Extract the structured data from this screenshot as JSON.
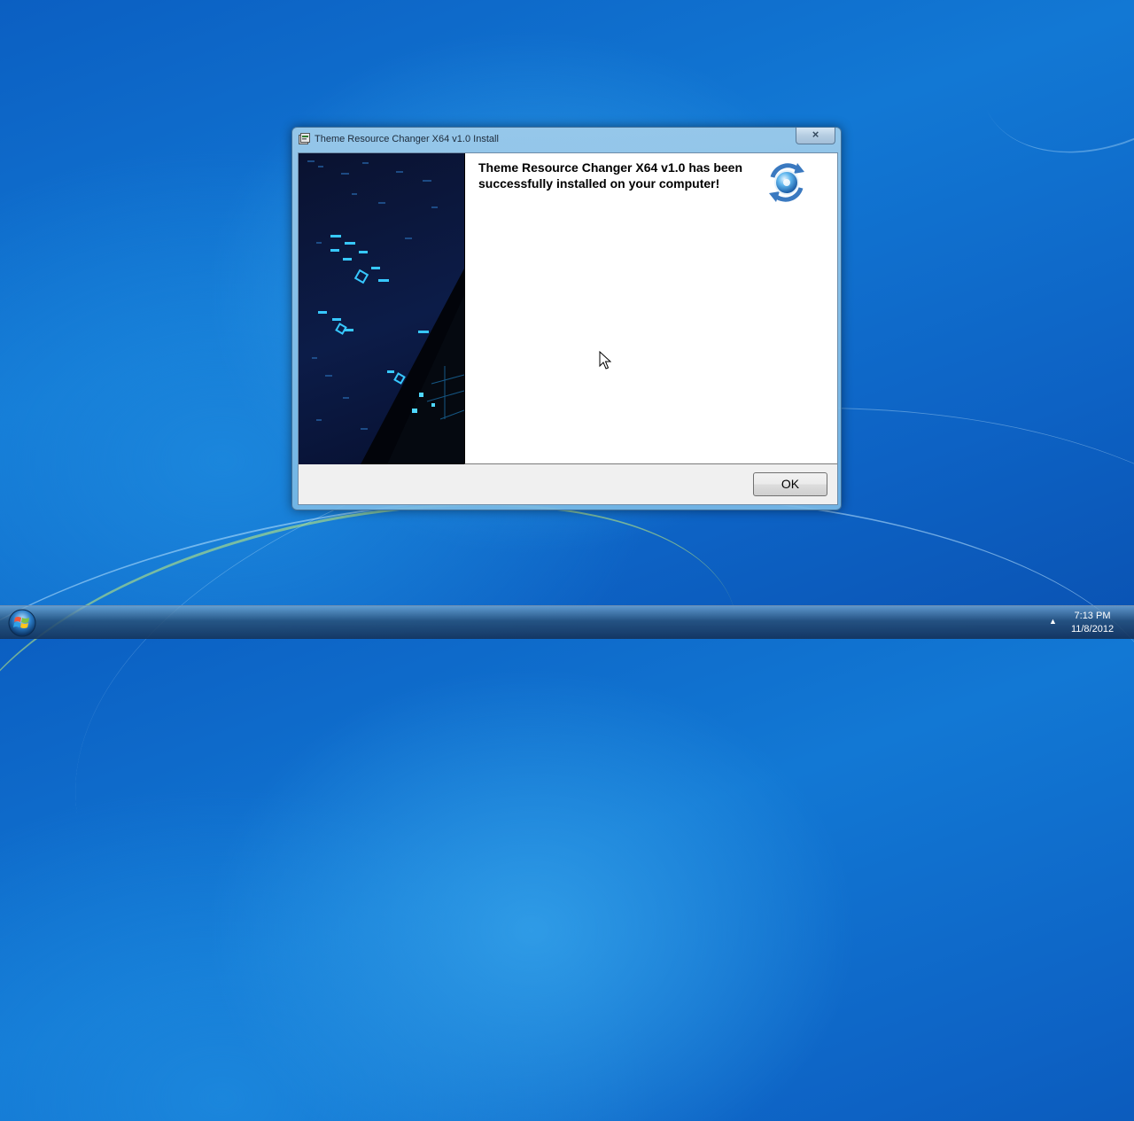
{
  "window": {
    "title": "Theme Resource Changer X64 v1.0 Install",
    "close_label": "×",
    "message": "Theme Resource Changer X64 v1.0 has been successfully installed on your computer!",
    "ok_label": "OK"
  },
  "taskbar": {
    "time": "7:13 PM",
    "date": "11/8/2012",
    "tray_arrow": "▲"
  },
  "icons": {
    "title": "installer-icon",
    "logo": "refresh-globe-icon",
    "start": "windows-start-orb-icon",
    "cursor": "mouse-pointer-icon"
  },
  "colors": {
    "desktop": "#1278d4",
    "banner": "#0c1c48",
    "banner_accent": "#37c8ff"
  }
}
